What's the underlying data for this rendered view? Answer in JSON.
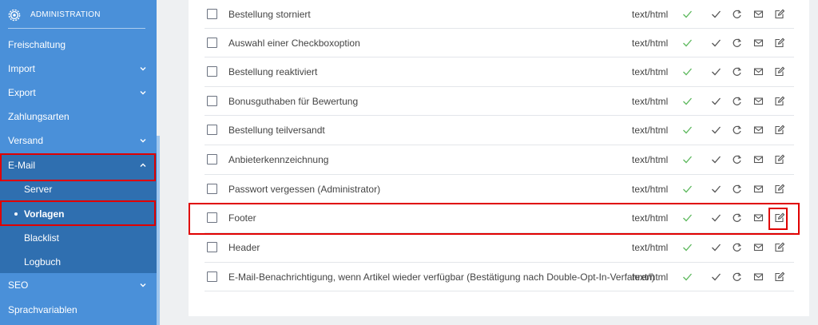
{
  "sidebar": {
    "header": {
      "title": "ADMINISTRATION",
      "icon": "gear-icon"
    },
    "items": [
      {
        "label": "Freischaltung",
        "has_chevron": false
      },
      {
        "label": "Import",
        "has_chevron": true,
        "chevron": "chevron-down-icon"
      },
      {
        "label": "Export",
        "has_chevron": true,
        "chevron": "chevron-down-icon"
      },
      {
        "label": "Zahlungsarten",
        "has_chevron": false
      },
      {
        "label": "Versand",
        "has_chevron": true,
        "chevron": "chevron-down-icon"
      },
      {
        "label": "E-Mail",
        "has_chevron": true,
        "chevron": "chevron-up-icon",
        "expanded": true
      },
      {
        "label": "SEO",
        "has_chevron": true,
        "chevron": "chevron-down-icon"
      },
      {
        "label": "Sprachvariablen",
        "has_chevron": false
      }
    ],
    "email_subitems": [
      {
        "label": "Server"
      },
      {
        "label": "Vorlagen",
        "current": true
      },
      {
        "label": "Blacklist"
      },
      {
        "label": "Logbuch"
      }
    ]
  },
  "templates": {
    "rows": [
      {
        "name": "Bestellung storniert",
        "type": "text/html"
      },
      {
        "name": "Auswahl einer Checkboxoption",
        "type": "text/html"
      },
      {
        "name": "Bestellung reaktiviert",
        "type": "text/html"
      },
      {
        "name": "Bonusguthaben für Bewertung",
        "type": "text/html"
      },
      {
        "name": "Bestellung teilversandt",
        "type": "text/html"
      },
      {
        "name": "Anbieterkennzeichnung",
        "type": "text/html"
      },
      {
        "name": "Passwort vergessen (Administrator)",
        "type": "text/html"
      },
      {
        "name": "Footer",
        "type": "text/html"
      },
      {
        "name": "Header",
        "type": "text/html"
      },
      {
        "name": "E-Mail-Benachrichtigung, wenn Artikel wieder verfügbar (Bestätigung nach Double-Opt-In-Verfahren)",
        "type": "text/html"
      }
    ],
    "row_icons": [
      "check-icon",
      "check-icon",
      "refresh-icon",
      "mail-icon",
      "edit-icon"
    ]
  },
  "colors": {
    "sidebar_bg": "#4a90d9",
    "sidebar_active": "#2f6fb0",
    "check_active": "#5cb85c",
    "check_muted": "#555555",
    "highlight": "#e00000"
  }
}
